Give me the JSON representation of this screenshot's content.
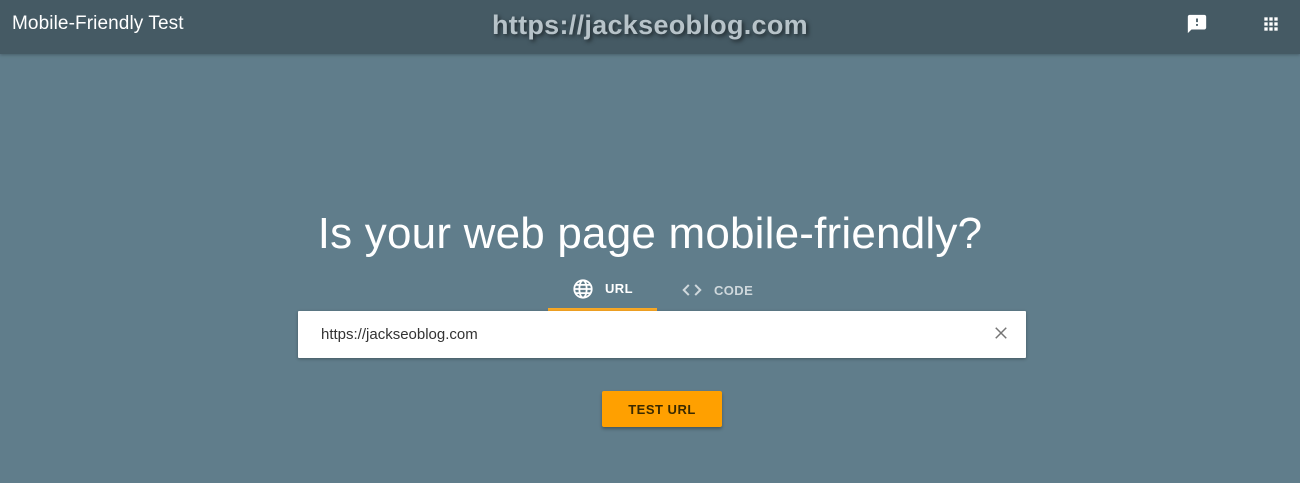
{
  "header": {
    "app_title": "Mobile-Friendly Test",
    "watermark": "https://jackseoblog.com",
    "feedback_icon": "feedback-icon",
    "apps_icon": "apps-grid-icon"
  },
  "main": {
    "headline": "Is your web page mobile-friendly?",
    "tabs": [
      {
        "label": "URL",
        "icon": "globe-icon",
        "selected": true
      },
      {
        "label": "CODE",
        "icon": "code-brackets-icon",
        "selected": false
      }
    ],
    "url_input": {
      "value": "https://jackseoblog.com",
      "clear_icon": "close-icon"
    },
    "test_button_label": "TEST URL"
  },
  "colors": {
    "page_background": "#607d8b",
    "topbar_background": "#455a64",
    "tab_indicator": "#f9a825",
    "button_accent": "#ffa000"
  }
}
